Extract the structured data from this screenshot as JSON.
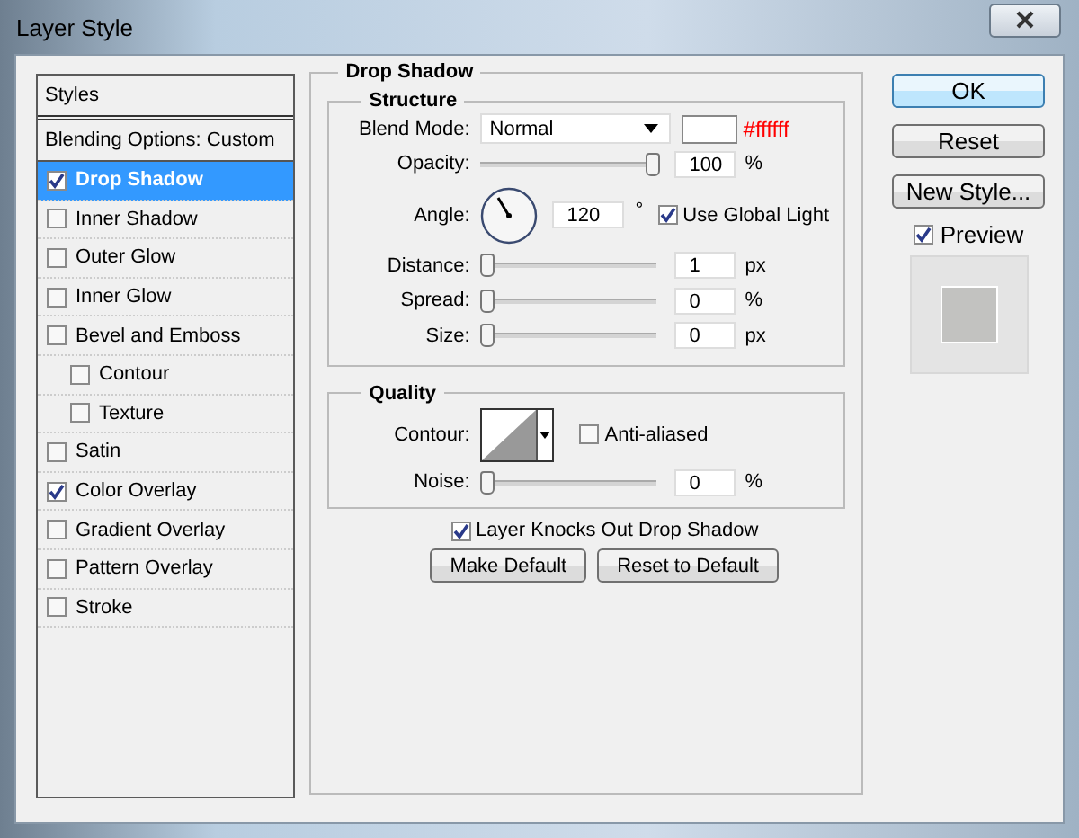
{
  "window": {
    "title": "Layer Style"
  },
  "styles_panel": {
    "header": "Styles",
    "blending": "Blending Options: Custom",
    "items": [
      {
        "label": "Drop Shadow",
        "checked": true,
        "selected": true
      },
      {
        "label": "Inner Shadow",
        "checked": false,
        "selected": false
      },
      {
        "label": "Outer Glow",
        "checked": false,
        "selected": false
      },
      {
        "label": "Inner Glow",
        "checked": false,
        "selected": false
      },
      {
        "label": "Bevel and Emboss",
        "checked": false,
        "selected": false,
        "children": [
          {
            "label": "Contour",
            "checked": false,
            "selected": false
          },
          {
            "label": "Texture",
            "checked": false,
            "selected": false
          }
        ]
      },
      {
        "label": "Satin",
        "checked": false,
        "selected": false
      },
      {
        "label": "Color Overlay",
        "checked": true,
        "selected": false
      },
      {
        "label": "Gradient Overlay",
        "checked": false,
        "selected": false
      },
      {
        "label": "Pattern Overlay",
        "checked": false,
        "selected": false
      },
      {
        "label": "Stroke",
        "checked": false,
        "selected": false
      }
    ]
  },
  "drop_shadow": {
    "title": "Drop Shadow",
    "structure": {
      "title": "Structure",
      "blend_mode": {
        "label": "Blend Mode:",
        "value": "Normal",
        "color_hex": "#ffffff"
      },
      "opacity": {
        "label": "Opacity:",
        "level": 1,
        "value": "100",
        "unit": "%"
      },
      "angle": {
        "label": "Angle:",
        "value": "120",
        "unit": "°",
        "global_light": {
          "label": "Use Global Light",
          "checked": true
        }
      },
      "sliders": [
        {
          "label": "Distance:",
          "level": 0,
          "value": "1",
          "unit": "px"
        },
        {
          "label": "Spread:",
          "level": 0,
          "value": "0",
          "unit": "%"
        },
        {
          "label": "Size:",
          "level": 0,
          "value": "0",
          "unit": "px"
        }
      ]
    },
    "quality": {
      "title": "Quality",
      "contour": {
        "label": "Contour:",
        "anti_aliased": {
          "label": "Anti-aliased",
          "checked": false
        }
      },
      "noise": {
        "label": "Noise:",
        "level": 0,
        "value": "0",
        "unit": "%"
      }
    },
    "knockout": {
      "label": "Layer Knocks Out Drop Shadow",
      "checked": true
    },
    "buttons": [
      "Make Default",
      "Reset to Default"
    ]
  },
  "actions": {
    "buttons": [
      {
        "label": "OK",
        "default": true
      },
      {
        "label": "Reset",
        "default": false
      },
      {
        "label": "New Style...",
        "default": false
      }
    ],
    "preview": {
      "label": "Preview",
      "checked": true
    }
  }
}
